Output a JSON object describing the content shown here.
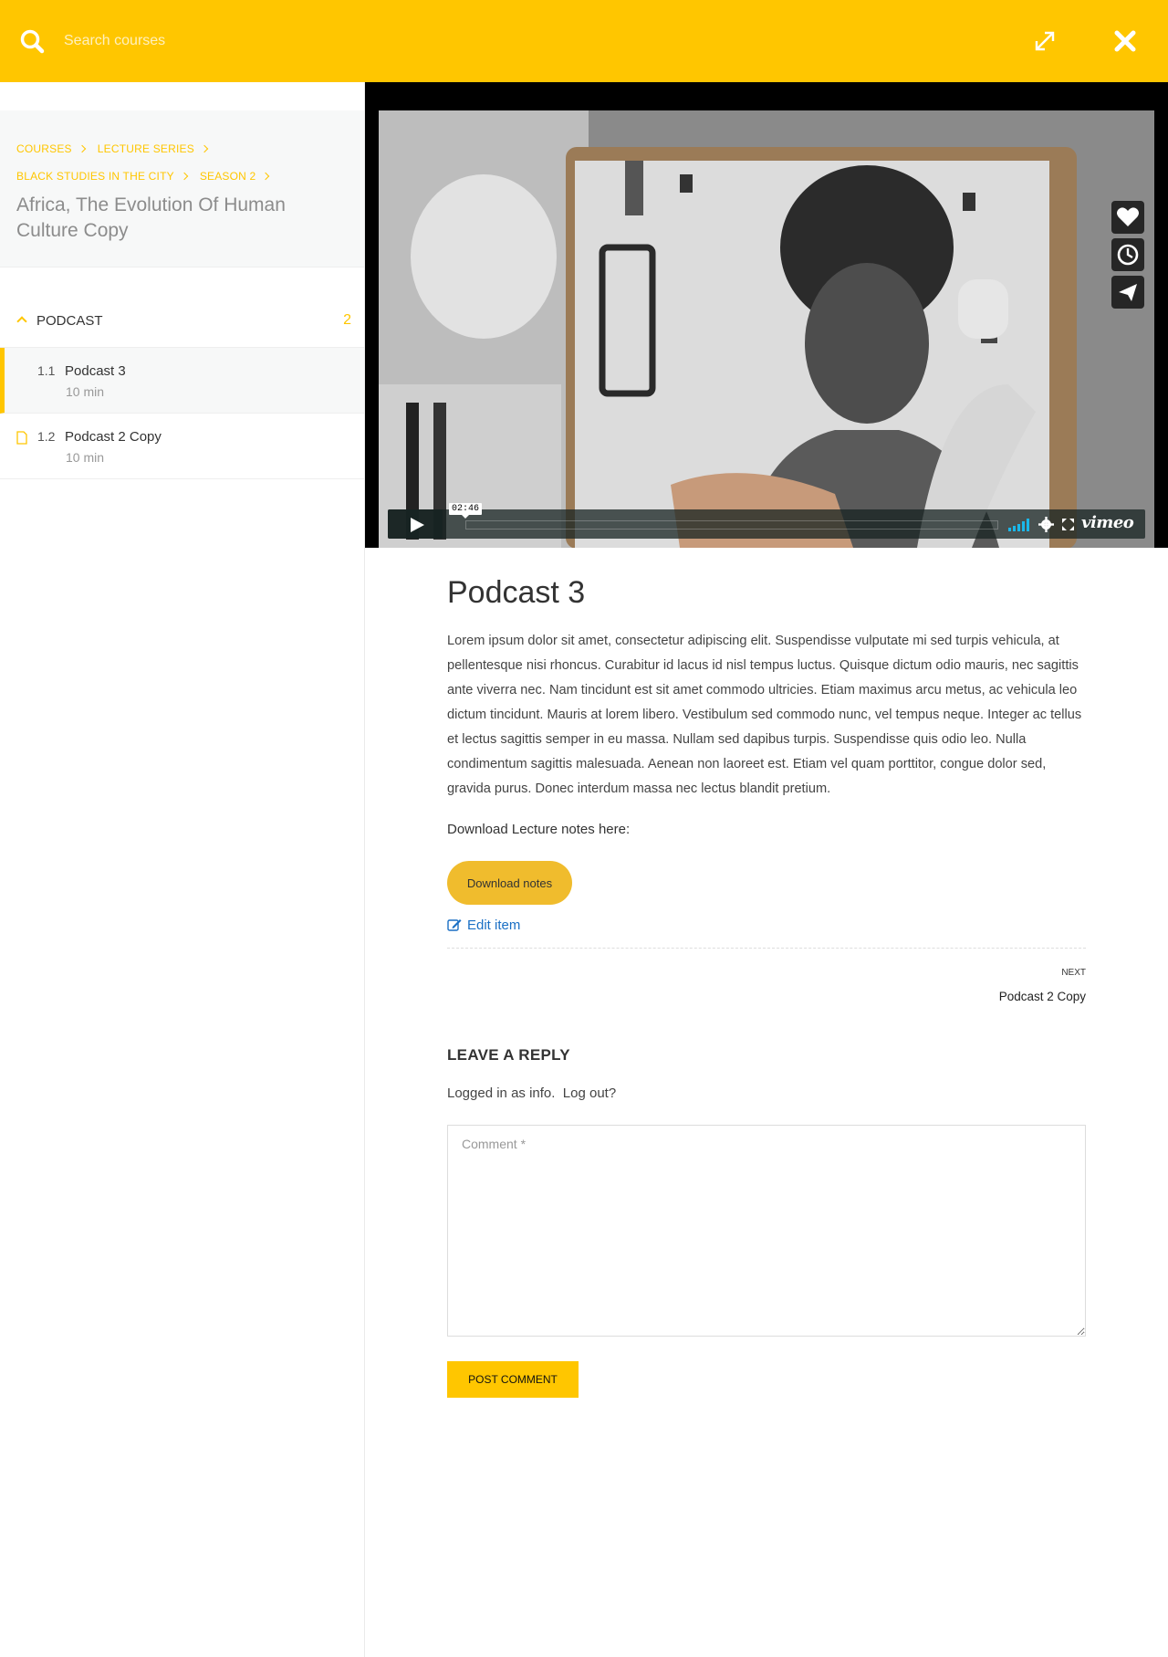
{
  "search": {
    "placeholder": "Search courses"
  },
  "icons": {
    "search": "search-icon",
    "expand": "expand-icon",
    "close": "close-icon"
  },
  "colors": {
    "accent": "#ffc600",
    "download_button": "#f0bc2d",
    "link": "#1a6fc4",
    "vimeo_volume": "#1ab7ea"
  },
  "sidebar": {
    "breadcrumbs": [
      "COURSES",
      "LECTURE SERIES",
      "BLACK STUDIES IN THE CITY",
      "SEASON 2"
    ],
    "course_title": "Africa, The Evolution Of Human Culture Copy",
    "section": {
      "title": "PODCAST",
      "count": "2"
    },
    "lessons": [
      {
        "num": "1.1",
        "name": "Podcast 3",
        "duration": "10 min",
        "active": true
      },
      {
        "num": "1.2",
        "name": "Podcast 2 Copy",
        "duration": "10 min",
        "active": false
      }
    ]
  },
  "video": {
    "time": "02:46",
    "brand": "vimeo",
    "side_buttons": [
      "heart-icon",
      "clock-icon",
      "send-icon"
    ]
  },
  "lesson": {
    "title": "Podcast 3",
    "body": "Lorem ipsum dolor sit amet, consectetur adipiscing elit. Suspendisse vulputate mi sed turpis vehicula, at pellentesque nisi rhoncus. Curabitur id lacus id nisl tempus luctus. Quisque dictum odio mauris, nec sagittis ante viverra nec.  Nam tincidunt est sit amet commodo ultricies.  Etiam maximus arcu metus, ac vehicula leo dictum tincidunt.  Mauris at lorem libero. Vestibulum sed commodo nunc, vel tempus neque. Integer ac tellus et lectus sagittis semper in eu massa.  Nullam sed dapibus turpis. Suspendisse quis odio leo.  Nulla condimentum sagittis malesuada. Aenean non laoreet est.  Etiam vel quam porttitor, congue dolor sed, gravida purus.  Donec interdum massa nec lectus blandit pretium.",
    "download_label": "Download  Lecture notes here:",
    "download_button": "Download notes",
    "edit_link": "Edit item"
  },
  "nav": {
    "next_label": "NEXT",
    "next_title": "Podcast 2 Copy"
  },
  "reply": {
    "heading": "LEAVE A  REPLY",
    "logged_in": "Logged in as info.",
    "logout": "Log out?",
    "comment_placeholder": "Comment *",
    "post_button": "POST COMMENT"
  }
}
